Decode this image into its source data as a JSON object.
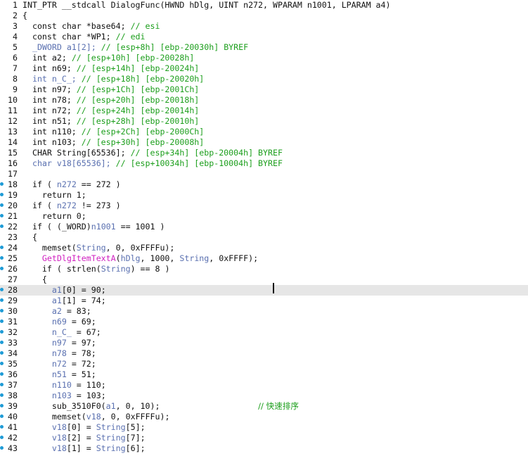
{
  "editor": {
    "lines": [
      {
        "n": "1",
        "bp": false,
        "segs": [
          {
            "t": "INT_PTR __stdcall DialogFunc(HWND hDlg, UINT n272, WPARAM n1001, LPARAM a4)",
            "c": "plain"
          }
        ]
      },
      {
        "n": "2",
        "bp": false,
        "segs": [
          {
            "t": "{",
            "c": "plain"
          }
        ]
      },
      {
        "n": "3",
        "bp": false,
        "segs": [
          {
            "t": "  const char *base64; ",
            "c": "plain"
          },
          {
            "t": "// esi",
            "c": "comment"
          }
        ]
      },
      {
        "n": "4",
        "bp": false,
        "segs": [
          {
            "t": "  const char *WP1; ",
            "c": "plain"
          },
          {
            "t": "// edi",
            "c": "comment"
          }
        ]
      },
      {
        "n": "5",
        "bp": false,
        "segs": [
          {
            "t": "  _DWORD a1[2]; ",
            "c": "var"
          },
          {
            "t": "// [esp+8h] [ebp-20030h] BYREF",
            "c": "comment"
          }
        ]
      },
      {
        "n": "6",
        "bp": false,
        "segs": [
          {
            "t": "  int a2; ",
            "c": "plain"
          },
          {
            "t": "// [esp+10h] [ebp-20028h]",
            "c": "comment"
          }
        ]
      },
      {
        "n": "7",
        "bp": false,
        "segs": [
          {
            "t": "  int n69; ",
            "c": "plain"
          },
          {
            "t": "// [esp+14h] [ebp-20024h]",
            "c": "comment"
          }
        ]
      },
      {
        "n": "8",
        "bp": false,
        "segs": [
          {
            "t": "  int n_C_; ",
            "c": "var"
          },
          {
            "t": "// [esp+18h] [ebp-20020h]",
            "c": "comment"
          }
        ]
      },
      {
        "n": "9",
        "bp": false,
        "segs": [
          {
            "t": "  int n97; ",
            "c": "plain"
          },
          {
            "t": "// [esp+1Ch] [ebp-2001Ch]",
            "c": "comment"
          }
        ]
      },
      {
        "n": "10",
        "bp": false,
        "segs": [
          {
            "t": "  int n78; ",
            "c": "plain"
          },
          {
            "t": "// [esp+20h] [ebp-20018h]",
            "c": "comment"
          }
        ]
      },
      {
        "n": "11",
        "bp": false,
        "segs": [
          {
            "t": "  int n72; ",
            "c": "plain"
          },
          {
            "t": "// [esp+24h] [ebp-20014h]",
            "c": "comment"
          }
        ]
      },
      {
        "n": "12",
        "bp": false,
        "segs": [
          {
            "t": "  int n51; ",
            "c": "plain"
          },
          {
            "t": "// [esp+28h] [ebp-20010h]",
            "c": "comment"
          }
        ]
      },
      {
        "n": "13",
        "bp": false,
        "segs": [
          {
            "t": "  int n110; ",
            "c": "plain"
          },
          {
            "t": "// [esp+2Ch] [ebp-2000Ch]",
            "c": "comment"
          }
        ]
      },
      {
        "n": "14",
        "bp": false,
        "segs": [
          {
            "t": "  int n103; ",
            "c": "plain"
          },
          {
            "t": "// [esp+30h] [ebp-20008h]",
            "c": "comment"
          }
        ]
      },
      {
        "n": "15",
        "bp": false,
        "segs": [
          {
            "t": "  CHAR String[65536]; ",
            "c": "plain"
          },
          {
            "t": "// [esp+34h] [ebp-20004h] BYREF",
            "c": "comment"
          }
        ]
      },
      {
        "n": "16",
        "bp": false,
        "segs": [
          {
            "t": "  char v18[65536]; ",
            "c": "var"
          },
          {
            "t": "// [esp+10034h] [ebp-10004h] BYREF",
            "c": "comment"
          }
        ]
      },
      {
        "n": "17",
        "bp": false,
        "segs": [
          {
            "t": "",
            "c": "plain"
          }
        ]
      },
      {
        "n": "18",
        "bp": true,
        "segs": [
          {
            "t": "  if ( ",
            "c": "plain"
          },
          {
            "t": "n272",
            "c": "var"
          },
          {
            "t": " == 272 )",
            "c": "plain"
          }
        ]
      },
      {
        "n": "19",
        "bp": true,
        "segs": [
          {
            "t": "    return 1;",
            "c": "plain"
          }
        ]
      },
      {
        "n": "20",
        "bp": true,
        "segs": [
          {
            "t": "  if ( ",
            "c": "plain"
          },
          {
            "t": "n272",
            "c": "var"
          },
          {
            "t": " != 273 )",
            "c": "plain"
          }
        ]
      },
      {
        "n": "21",
        "bp": true,
        "segs": [
          {
            "t": "    return 0;",
            "c": "plain"
          }
        ]
      },
      {
        "n": "22",
        "bp": true,
        "segs": [
          {
            "t": "  if ( (_WORD)",
            "c": "plain"
          },
          {
            "t": "n1001",
            "c": "var"
          },
          {
            "t": " == 1001 )",
            "c": "plain"
          }
        ]
      },
      {
        "n": "23",
        "bp": false,
        "segs": [
          {
            "t": "  {",
            "c": "plain"
          }
        ]
      },
      {
        "n": "24",
        "bp": true,
        "segs": [
          {
            "t": "    memset(",
            "c": "plain"
          },
          {
            "t": "String",
            "c": "var"
          },
          {
            "t": ", 0, 0xFFFFu);",
            "c": "plain"
          }
        ]
      },
      {
        "n": "25",
        "bp": true,
        "segs": [
          {
            "t": "    ",
            "c": "plain"
          },
          {
            "t": "GetDlgItemTextA",
            "c": "func"
          },
          {
            "t": "(",
            "c": "plain"
          },
          {
            "t": "hDlg",
            "c": "var"
          },
          {
            "t": ", 1000, ",
            "c": "plain"
          },
          {
            "t": "String",
            "c": "var"
          },
          {
            "t": ", 0xFFFF);",
            "c": "plain"
          }
        ]
      },
      {
        "n": "26",
        "bp": true,
        "segs": [
          {
            "t": "    if ( strlen(",
            "c": "plain"
          },
          {
            "t": "String",
            "c": "var"
          },
          {
            "t": ") == 8 )",
            "c": "plain"
          }
        ]
      },
      {
        "n": "27",
        "bp": false,
        "segs": [
          {
            "t": "    {",
            "c": "plain"
          }
        ]
      },
      {
        "n": "28",
        "bp": true,
        "current": true,
        "segs": [
          {
            "t": "      ",
            "c": "plain"
          },
          {
            "t": "a1",
            "c": "var"
          },
          {
            "t": "[0] = 90;",
            "c": "plain"
          }
        ]
      },
      {
        "n": "29",
        "bp": true,
        "segs": [
          {
            "t": "      ",
            "c": "plain"
          },
          {
            "t": "a1",
            "c": "var"
          },
          {
            "t": "[1] = 74;",
            "c": "plain"
          }
        ]
      },
      {
        "n": "30",
        "bp": true,
        "segs": [
          {
            "t": "      ",
            "c": "plain"
          },
          {
            "t": "a2",
            "c": "var"
          },
          {
            "t": " = 83;",
            "c": "plain"
          }
        ]
      },
      {
        "n": "31",
        "bp": true,
        "segs": [
          {
            "t": "      ",
            "c": "plain"
          },
          {
            "t": "n69",
            "c": "var"
          },
          {
            "t": " = 69;",
            "c": "plain"
          }
        ]
      },
      {
        "n": "32",
        "bp": true,
        "segs": [
          {
            "t": "      ",
            "c": "plain"
          },
          {
            "t": "n_C_",
            "c": "var"
          },
          {
            "t": " = 67;",
            "c": "plain"
          }
        ]
      },
      {
        "n": "33",
        "bp": true,
        "segs": [
          {
            "t": "      ",
            "c": "plain"
          },
          {
            "t": "n97",
            "c": "var"
          },
          {
            "t": " = 97;",
            "c": "plain"
          }
        ]
      },
      {
        "n": "34",
        "bp": true,
        "segs": [
          {
            "t": "      ",
            "c": "plain"
          },
          {
            "t": "n78",
            "c": "var"
          },
          {
            "t": " = 78;",
            "c": "plain"
          }
        ]
      },
      {
        "n": "35",
        "bp": true,
        "segs": [
          {
            "t": "      ",
            "c": "plain"
          },
          {
            "t": "n72",
            "c": "var"
          },
          {
            "t": " = 72;",
            "c": "plain"
          }
        ]
      },
      {
        "n": "36",
        "bp": true,
        "segs": [
          {
            "t": "      ",
            "c": "plain"
          },
          {
            "t": "n51",
            "c": "var"
          },
          {
            "t": " = 51;",
            "c": "plain"
          }
        ]
      },
      {
        "n": "37",
        "bp": true,
        "segs": [
          {
            "t": "      ",
            "c": "plain"
          },
          {
            "t": "n110",
            "c": "var"
          },
          {
            "t": " = 110;",
            "c": "plain"
          }
        ]
      },
      {
        "n": "38",
        "bp": true,
        "segs": [
          {
            "t": "      ",
            "c": "plain"
          },
          {
            "t": "n103",
            "c": "var"
          },
          {
            "t": " = 103;",
            "c": "plain"
          }
        ]
      },
      {
        "n": "39",
        "bp": true,
        "segs": [
          {
            "t": "      sub_3510F0(",
            "c": "plain"
          },
          {
            "t": "a1",
            "c": "var"
          },
          {
            "t": ", 0, 10);                    ",
            "c": "plain"
          },
          {
            "t": "// 快速排序",
            "c": "comment"
          }
        ]
      },
      {
        "n": "40",
        "bp": true,
        "segs": [
          {
            "t": "      memset(",
            "c": "plain"
          },
          {
            "t": "v18",
            "c": "var"
          },
          {
            "t": ", 0, 0xFFFFu);",
            "c": "plain"
          }
        ]
      },
      {
        "n": "41",
        "bp": true,
        "segs": [
          {
            "t": "      ",
            "c": "plain"
          },
          {
            "t": "v18",
            "c": "var"
          },
          {
            "t": "[0] = ",
            "c": "plain"
          },
          {
            "t": "String",
            "c": "var"
          },
          {
            "t": "[5];",
            "c": "plain"
          }
        ]
      },
      {
        "n": "42",
        "bp": true,
        "segs": [
          {
            "t": "      ",
            "c": "plain"
          },
          {
            "t": "v18",
            "c": "var"
          },
          {
            "t": "[2] = ",
            "c": "plain"
          },
          {
            "t": "String",
            "c": "var"
          },
          {
            "t": "[7];",
            "c": "plain"
          }
        ]
      },
      {
        "n": "43",
        "bp": true,
        "segs": [
          {
            "t": "      ",
            "c": "plain"
          },
          {
            "t": "v18",
            "c": "var"
          },
          {
            "t": "[1] = ",
            "c": "plain"
          },
          {
            "t": "String",
            "c": "var"
          },
          {
            "t": "[6];",
            "c": "plain"
          }
        ]
      }
    ]
  }
}
